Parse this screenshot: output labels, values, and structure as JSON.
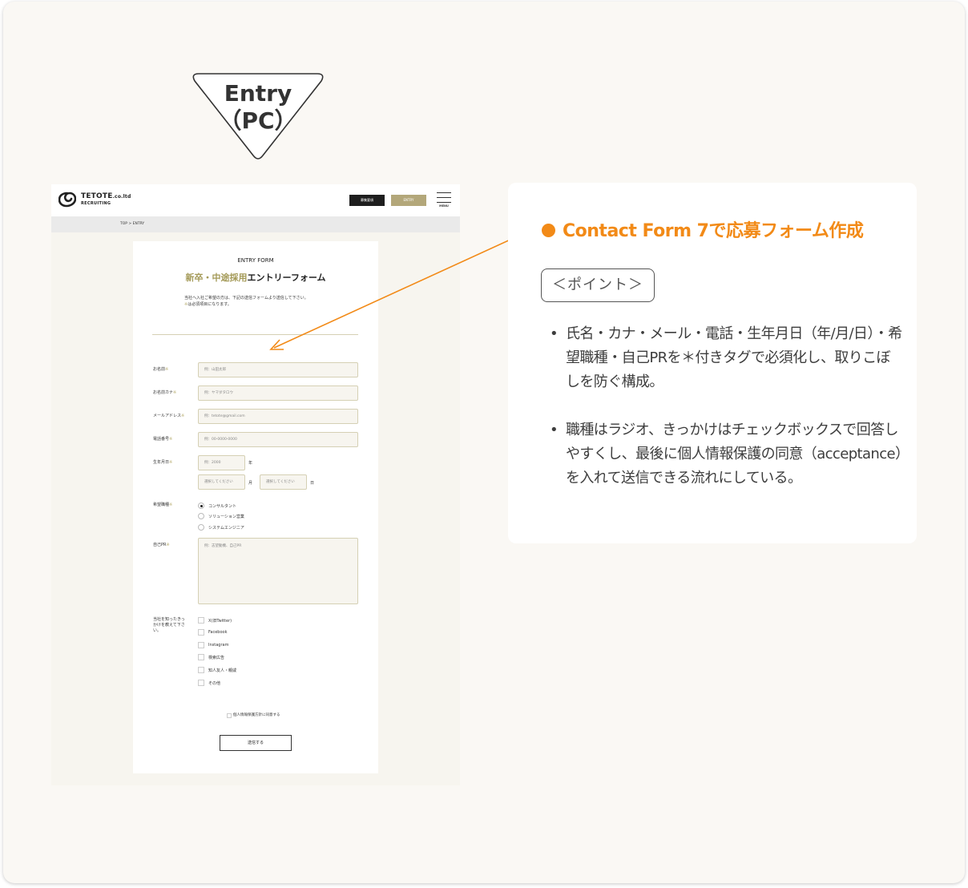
{
  "badge": {
    "line1": "Entry",
    "line2": "（PC）"
  },
  "site": {
    "logo": {
      "name": "TETOTE",
      "suffix": ".co.ltd",
      "sub": "RECRUITING"
    },
    "header": {
      "btn_recruit": "募集要項",
      "btn_entry": "ENTRY",
      "menu_label": "MENU"
    },
    "breadcrumb": "TOP > ENTRY",
    "form": {
      "eyebrow": "ENTRY FORM",
      "title_accent": "新卒・中途採用",
      "title_rest": "エントリーフォーム",
      "intro_line1": "当社へ入社ご希望の方は、下記の送信フォームより送信して下さい。",
      "intro_mark": "※",
      "intro_line2_rest": "は必須項目になります。",
      "required_mark": "※",
      "fields": {
        "name": {
          "label": "お名前",
          "placeholder": "例：山田太郎"
        },
        "kana": {
          "label": "お名前カナ",
          "placeholder": "例：ヤマダタロウ"
        },
        "email": {
          "label": "メールアドレス",
          "placeholder": "例：tetote@gmail.com"
        },
        "phone": {
          "label": "電話番号",
          "placeholder": "例：00-0000-0000"
        },
        "birth": {
          "label": "生年月日",
          "year_placeholder": "例：2000",
          "year_unit": "年",
          "month_placeholder": "選択してください",
          "month_unit": "月",
          "day_placeholder": "選択してください",
          "day_unit": "日"
        },
        "job": {
          "label": "希望職種",
          "options": [
            "コンサルタント",
            "ソリューション営業",
            "システムエンジニア"
          ],
          "selected": 0
        },
        "pr": {
          "label": "自己PR",
          "placeholder": "例：志望動機、自己PR"
        },
        "source": {
          "label_l1": "当社を知ったきっ",
          "label_l2": "かけを教えて下さ",
          "label_l3": "い。",
          "options": [
            "X(旧Twitter)",
            "Facebook",
            "Instagram",
            "検索広告",
            "知人友人・親戚",
            "その他"
          ]
        }
      },
      "agree": "個人情報保護方針に同意する",
      "submit": "送信する"
    }
  },
  "panel": {
    "heading": "Contact Form 7で応募フォーム作成",
    "tag": "＜ポイント＞",
    "points": [
      "氏名・カナ・メール・電話・生年月日（年/月/日）・希望職種・自己PRを＊付きタグで必須化し、取りこぼしを防ぐ構成。",
      "職種はラジオ、きっかけはチェックボックスで回答しやすくし、最後に個人情報保護の同意（acceptance）を入れて送信できる流れにしている。"
    ]
  },
  "colors": {
    "accent": "#f28a17",
    "gold": "#b3a77a",
    "site_bg": "#f7f5ef"
  }
}
